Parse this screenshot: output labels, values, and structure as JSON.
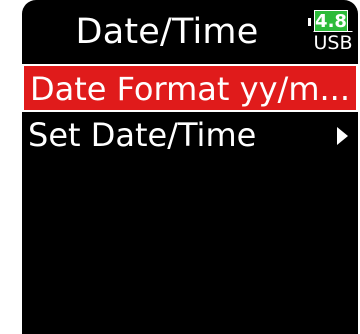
{
  "header": {
    "title": "Date/Time"
  },
  "status": {
    "battery_level": "4.8",
    "power_source": "USB",
    "battery_color": "#2dbb3a"
  },
  "menu": {
    "items": [
      {
        "label": "Date Format",
        "value": "yy/m...",
        "selected": true
      },
      {
        "label": "Set Date/Time",
        "value": "",
        "icon": "chevron-right-icon"
      }
    ]
  },
  "colors": {
    "selection": "#e01b1b",
    "background": "#000000",
    "text": "#ffffff"
  }
}
